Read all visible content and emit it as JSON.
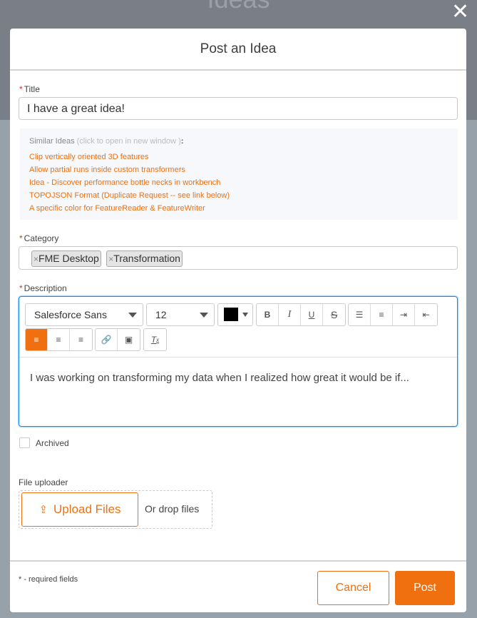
{
  "background": {
    "page_title": "Ideas"
  },
  "modal": {
    "title": "Post an Idea",
    "title_field": {
      "label": "Title",
      "required_mark": "*",
      "value": "I have a great idea!"
    },
    "similar": {
      "heading": "Similar Ideas",
      "hint": "(click to open in new window )",
      "colon": ":",
      "items": [
        "Clip vertically oriented 3D features",
        "Allow partial runs inside custom transformers",
        "Idea - Discover performance bottle necks in workbench",
        "TOPOJSON Format (Duplicate Request -- see link below)",
        "A specific color for FeatureReader & FeatureWriter"
      ]
    },
    "category": {
      "label": "Category",
      "required_mark": "*",
      "remove_glyph": "×",
      "tags": [
        "FME Desktop",
        "Transformation"
      ]
    },
    "description": {
      "label": "Description",
      "required_mark": "*",
      "font": "Salesforce Sans",
      "size": "12",
      "text_color": "#000000",
      "body": "I was working on transforming my data when I realized how great it would be if..."
    },
    "archived": {
      "label": "Archived",
      "checked": false
    },
    "file_uploader": {
      "label": "File uploader",
      "upload_label": "Upload Files",
      "drop_label": "Or drop files"
    },
    "footer": {
      "required_note": "* - required fields",
      "cancel": "Cancel",
      "post": "Post"
    }
  },
  "colors": {
    "accent": "#f07010",
    "focus": "#1589ee"
  }
}
